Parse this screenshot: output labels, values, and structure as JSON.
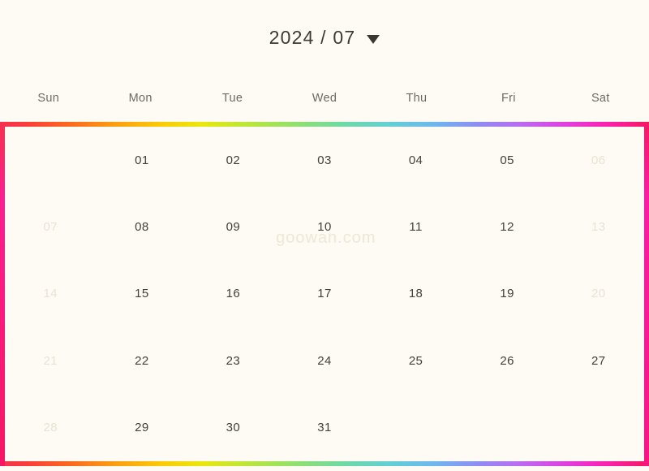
{
  "header": {
    "period_label": "2024 / 07",
    "year": "2024",
    "month": "07",
    "dropdown_icon": "chevron-down-icon"
  },
  "weekdays": [
    {
      "label": "Sun",
      "is_weekend": true
    },
    {
      "label": "Mon",
      "is_weekend": false
    },
    {
      "label": "Tue",
      "is_weekend": false
    },
    {
      "label": "Wed",
      "is_weekend": false
    },
    {
      "label": "Thu",
      "is_weekend": false
    },
    {
      "label": "Fri",
      "is_weekend": false
    },
    {
      "label": "Sat",
      "is_weekend": true
    }
  ],
  "weeks": [
    [
      {
        "label": "",
        "state": "blank"
      },
      {
        "label": "01",
        "state": "normal"
      },
      {
        "label": "02",
        "state": "normal"
      },
      {
        "label": "03",
        "state": "normal"
      },
      {
        "label": "04",
        "state": "normal"
      },
      {
        "label": "05",
        "state": "normal"
      },
      {
        "label": "06",
        "state": "muted"
      }
    ],
    [
      {
        "label": "07",
        "state": "muted"
      },
      {
        "label": "08",
        "state": "normal"
      },
      {
        "label": "09",
        "state": "normal"
      },
      {
        "label": "10",
        "state": "normal"
      },
      {
        "label": "11",
        "state": "normal"
      },
      {
        "label": "12",
        "state": "normal"
      },
      {
        "label": "13",
        "state": "muted"
      }
    ],
    [
      {
        "label": "14",
        "state": "muted"
      },
      {
        "label": "15",
        "state": "normal"
      },
      {
        "label": "16",
        "state": "normal"
      },
      {
        "label": "17",
        "state": "normal"
      },
      {
        "label": "18",
        "state": "normal"
      },
      {
        "label": "19",
        "state": "normal"
      },
      {
        "label": "20",
        "state": "muted"
      }
    ],
    [
      {
        "label": "21",
        "state": "muted"
      },
      {
        "label": "22",
        "state": "normal"
      },
      {
        "label": "23",
        "state": "normal"
      },
      {
        "label": "24",
        "state": "normal"
      },
      {
        "label": "25",
        "state": "normal"
      },
      {
        "label": "26",
        "state": "normal"
      },
      {
        "label": "27",
        "state": "normal"
      }
    ],
    [
      {
        "label": "28",
        "state": "muted"
      },
      {
        "label": "29",
        "state": "normal"
      },
      {
        "label": "30",
        "state": "normal"
      },
      {
        "label": "31",
        "state": "normal"
      },
      {
        "label": "",
        "state": "blank"
      },
      {
        "label": "",
        "state": "blank"
      },
      {
        "label": "",
        "state": "blank"
      }
    ]
  ],
  "watermark": {
    "text": "goowan.com"
  },
  "colors": {
    "background": "#fdfbf3",
    "text_primary": "#44403c",
    "text_muted": "#e9e3d5",
    "weekday_label": "#6e6a63",
    "border_gradient_start": "#f5314f",
    "border_gradient_end": "#f5185f"
  }
}
